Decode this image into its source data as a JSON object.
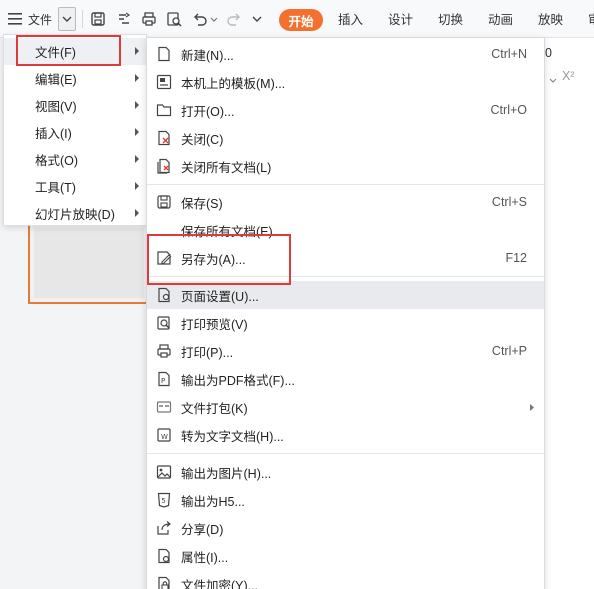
{
  "toolbar": {
    "menu_label": "文件",
    "tabs": [
      "开始",
      "插入",
      "设计",
      "切换",
      "动画",
      "放映",
      "审"
    ]
  },
  "right_pane": {
    "value": "0",
    "superscript": "X²"
  },
  "left_menu": {
    "items": [
      {
        "label": "文件(F)"
      },
      {
        "label": "编辑(E)"
      },
      {
        "label": "视图(V)"
      },
      {
        "label": "插入(I)"
      },
      {
        "label": "格式(O)"
      },
      {
        "label": "工具(T)"
      },
      {
        "label": "幻灯片放映(D)"
      }
    ]
  },
  "file_menu": {
    "items": [
      {
        "label": "新建(N)...",
        "shortcut": "Ctrl+N",
        "icon": "new-file-icon"
      },
      {
        "label": "本机上的模板(M)...",
        "shortcut": "",
        "icon": "template-icon"
      },
      {
        "label": "打开(O)...",
        "shortcut": "Ctrl+O",
        "icon": "open-folder-icon"
      },
      {
        "label": "关闭(C)",
        "shortcut": "",
        "icon": "close-file-icon"
      },
      {
        "label": "关闭所有文档(L)",
        "shortcut": "",
        "icon": "close-all-icon"
      },
      {
        "label": "保存(S)",
        "shortcut": "Ctrl+S",
        "icon": "save-icon"
      },
      {
        "label": "保存所有文档(E)",
        "shortcut": "",
        "icon": ""
      },
      {
        "label": "另存为(A)...",
        "shortcut": "F12",
        "icon": "save-as-icon"
      },
      {
        "label": "页面设置(U)...",
        "shortcut": "",
        "icon": "page-setup-icon"
      },
      {
        "label": "打印预览(V)",
        "shortcut": "",
        "icon": "print-preview-icon"
      },
      {
        "label": "打印(P)...",
        "shortcut": "Ctrl+P",
        "icon": "print-icon"
      },
      {
        "label": "输出为PDF格式(F)...",
        "shortcut": "",
        "icon": "pdf-icon"
      },
      {
        "label": "文件打包(K)",
        "shortcut": "",
        "icon": "package-icon"
      },
      {
        "label": "转为文字文档(H)...",
        "shortcut": "",
        "icon": "convert-doc-icon"
      },
      {
        "label": "输出为图片(H)...",
        "shortcut": "",
        "icon": "image-export-icon"
      },
      {
        "label": "输出为H5...",
        "shortcut": "",
        "icon": "h5-icon"
      },
      {
        "label": "分享(D)",
        "shortcut": "",
        "icon": "share-icon"
      },
      {
        "label": "属性(I)...",
        "shortcut": "",
        "icon": "properties-icon"
      },
      {
        "label": "文件加密(Y)...",
        "shortcut": "",
        "icon": "encrypt-icon"
      }
    ]
  },
  "colors": {
    "accent": "#f4702f",
    "highlight_box": "#e03b3b",
    "hover": "#e8eaee"
  }
}
